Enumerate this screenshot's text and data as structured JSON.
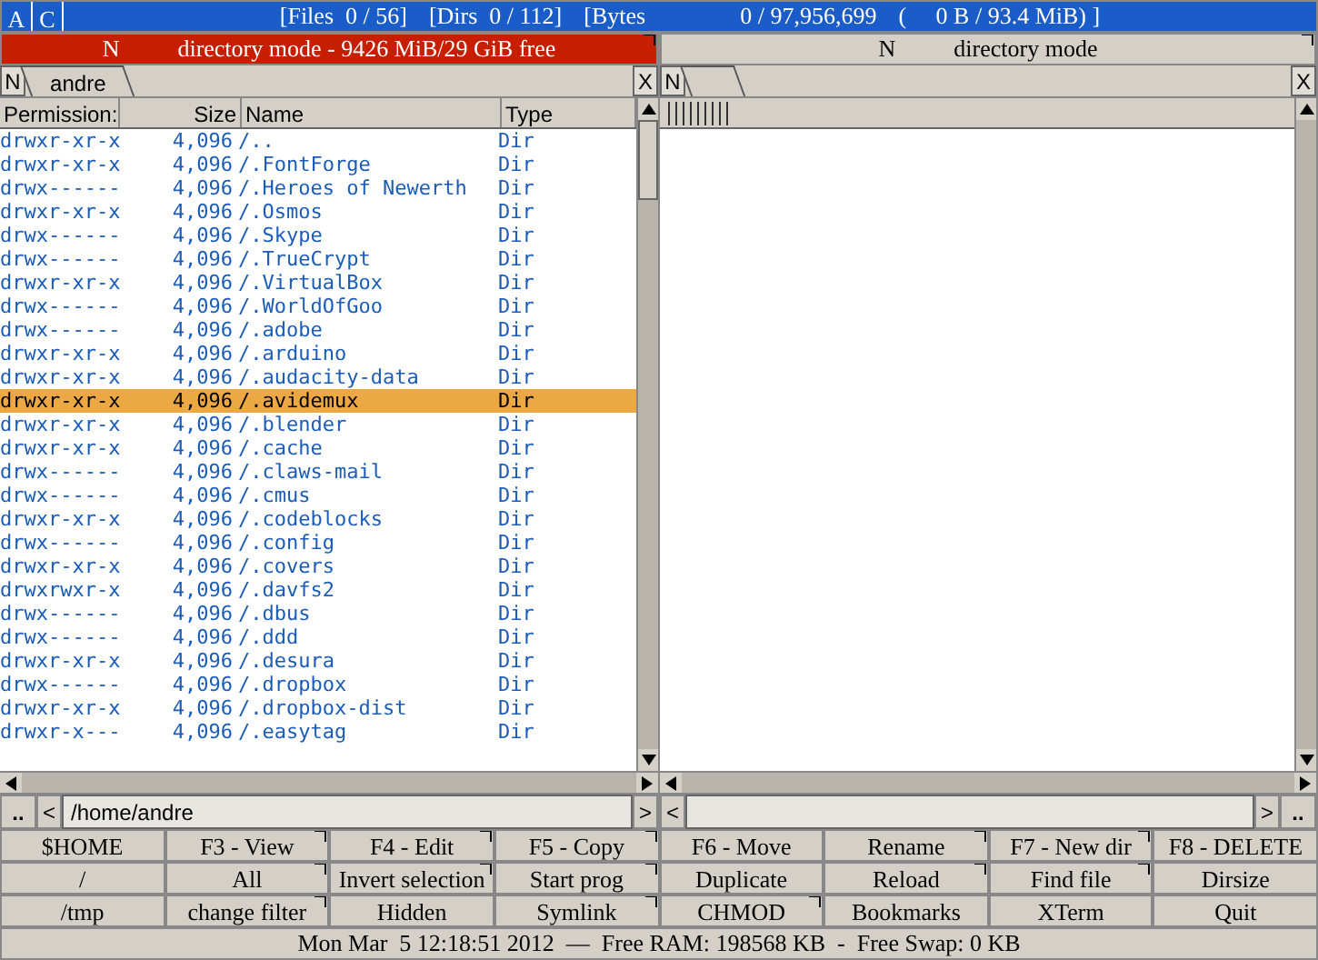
{
  "top_bar": {
    "buttons": [
      "A",
      "C"
    ],
    "files": "[Files  0 / 56]",
    "dirs": "[Dirs  0 / 112]",
    "bytes": "[Bytes",
    "bytes_value": "0 / 97,956,699",
    "bytes_human": "(     0 B / 93.4 MiB) ]"
  },
  "panels": [
    {
      "selected": true,
      "mode": "N",
      "title": "directory mode - 9426 MiB/29 GiB free",
      "new_tab": "N",
      "tabs": [
        {
          "label": "andre"
        }
      ],
      "close": "X",
      "columns": [
        "Permission:",
        "Size",
        "Name",
        "Type"
      ],
      "rows": [
        {
          "perm": "drwxr-xr-x",
          "size": "4,096",
          "name": "/..",
          "type": "Dir",
          "selected": false
        },
        {
          "perm": "drwxr-xr-x",
          "size": "4,096",
          "name": "/.FontForge",
          "type": "Dir",
          "selected": false
        },
        {
          "perm": "drwx------",
          "size": "4,096",
          "name": "/.Heroes of Newerth",
          "type": "Dir",
          "selected": false
        },
        {
          "perm": "drwxr-xr-x",
          "size": "4,096",
          "name": "/.Osmos",
          "type": "Dir",
          "selected": false
        },
        {
          "perm": "drwx------",
          "size": "4,096",
          "name": "/.Skype",
          "type": "Dir",
          "selected": false
        },
        {
          "perm": "drwx------",
          "size": "4,096",
          "name": "/.TrueCrypt",
          "type": "Dir",
          "selected": false
        },
        {
          "perm": "drwxr-xr-x",
          "size": "4,096",
          "name": "/.VirtualBox",
          "type": "Dir",
          "selected": false
        },
        {
          "perm": "drwx------",
          "size": "4,096",
          "name": "/.WorldOfGoo",
          "type": "Dir",
          "selected": false
        },
        {
          "perm": "drwx------",
          "size": "4,096",
          "name": "/.adobe",
          "type": "Dir",
          "selected": false
        },
        {
          "perm": "drwxr-xr-x",
          "size": "4,096",
          "name": "/.arduino",
          "type": "Dir",
          "selected": false
        },
        {
          "perm": "drwxr-xr-x",
          "size": "4,096",
          "name": "/.audacity-data",
          "type": "Dir",
          "selected": false
        },
        {
          "perm": "drwxr-xr-x",
          "size": "4,096",
          "name": "/.avidemux",
          "type": "Dir",
          "selected": true
        },
        {
          "perm": "drwxr-xr-x",
          "size": "4,096",
          "name": "/.blender",
          "type": "Dir",
          "selected": false
        },
        {
          "perm": "drwxr-xr-x",
          "size": "4,096",
          "name": "/.cache",
          "type": "Dir",
          "selected": false
        },
        {
          "perm": "drwx------",
          "size": "4,096",
          "name": "/.claws-mail",
          "type": "Dir",
          "selected": false
        },
        {
          "perm": "drwx------",
          "size": "4,096",
          "name": "/.cmus",
          "type": "Dir",
          "selected": false
        },
        {
          "perm": "drwxr-xr-x",
          "size": "4,096",
          "name": "/.codeblocks",
          "type": "Dir",
          "selected": false
        },
        {
          "perm": "drwx------",
          "size": "4,096",
          "name": "/.config",
          "type": "Dir",
          "selected": false
        },
        {
          "perm": "drwxr-xr-x",
          "size": "4,096",
          "name": "/.covers",
          "type": "Dir",
          "selected": false
        },
        {
          "perm": "drwxrwxr-x",
          "size": "4,096",
          "name": "/.davfs2",
          "type": "Dir",
          "selected": false
        },
        {
          "perm": "drwx------",
          "size": "4,096",
          "name": "/.dbus",
          "type": "Dir",
          "selected": false
        },
        {
          "perm": "drwx------",
          "size": "4,096",
          "name": "/.ddd",
          "type": "Dir",
          "selected": false
        },
        {
          "perm": "drwxr-xr-x",
          "size": "4,096",
          "name": "/.desura",
          "type": "Dir",
          "selected": false
        },
        {
          "perm": "drwx------",
          "size": "4,096",
          "name": "/.dropbox",
          "type": "Dir",
          "selected": false
        },
        {
          "perm": "drwxr-xr-x",
          "size": "4,096",
          "name": "/.dropbox-dist",
          "type": "Dir",
          "selected": false
        },
        {
          "perm": "drwxr-x---",
          "size": "4,096",
          "name": "/.easytag",
          "type": "Dir",
          "selected": false
        }
      ],
      "path_up": "..",
      "path_left": "<",
      "path": "/home/andre",
      "path_right": ">"
    },
    {
      "selected": false,
      "mode": "N",
      "title": "directory mode",
      "new_tab": "N",
      "close": "X",
      "path_up": "..",
      "path_left": "<",
      "path_right": ">"
    }
  ],
  "buttons": [
    {
      "label": "$HOME",
      "menu": false
    },
    {
      "label": "F3 - View",
      "menu": true
    },
    {
      "label": "F4 - Edit",
      "menu": true
    },
    {
      "label": "F5 - Copy",
      "menu": true
    },
    {
      "label": "F6 - Move",
      "menu": false
    },
    {
      "label": "Rename",
      "menu": true
    },
    {
      "label": "F7 - New dir",
      "menu": true
    },
    {
      "label": "F8 - DELETE",
      "menu": false
    },
    {
      "label": "/",
      "menu": false
    },
    {
      "label": "All",
      "menu": true
    },
    {
      "label": "Invert selection",
      "menu": true
    },
    {
      "label": "Start prog",
      "menu": true
    },
    {
      "label": "Duplicate",
      "menu": false
    },
    {
      "label": "Reload",
      "menu": true
    },
    {
      "label": "Find file",
      "menu": true
    },
    {
      "label": "Dirsize",
      "menu": false
    },
    {
      "label": "/tmp",
      "menu": false
    },
    {
      "label": "change filter",
      "menu": true
    },
    {
      "label": "Hidden",
      "menu": false
    },
    {
      "label": "Symlink",
      "menu": true
    },
    {
      "label": "CHMOD",
      "menu": true
    },
    {
      "label": "Bookmarks",
      "menu": false
    },
    {
      "label": "XTerm",
      "menu": false
    },
    {
      "label": "Quit",
      "menu": false
    }
  ],
  "status_bar": "Mon Mar  5 12:18:51 2012  —  Free RAM: 198568 KB  -  Free Swap: 0 KB"
}
